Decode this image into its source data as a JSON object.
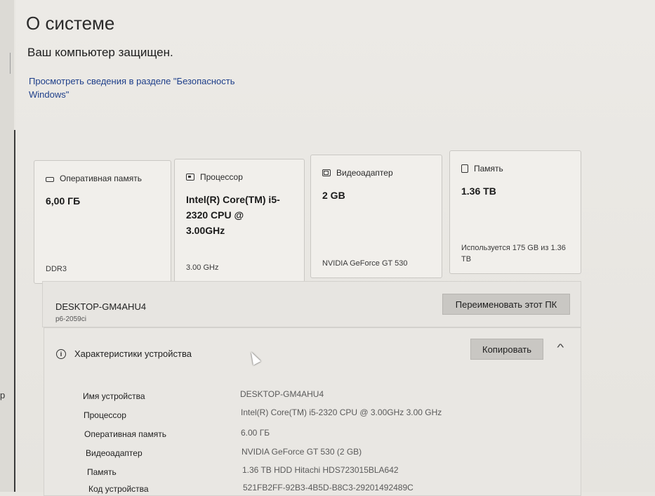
{
  "left_edge_char": "р",
  "page_title": "О системе",
  "protection_status": "Ваш компьютер защищен.",
  "security_link": "Просмотреть сведения в разделе \"Безопасность Windows\"",
  "cards": [
    {
      "icon": "ram-icon",
      "title": "Оперативная память",
      "value": "6,00 ГБ",
      "footer": "DDR3"
    },
    {
      "icon": "cpu-icon",
      "title": "Процессор",
      "value": "Intel(R) Core(TM) i5-2320 CPU @ 3.00GHz",
      "footer": "3.00 GHz"
    },
    {
      "icon": "gpu-icon",
      "title": "Видеоадаптер",
      "value": "2 GB",
      "footer": "NVIDIA GeForce GT 530"
    },
    {
      "icon": "storage-icon",
      "title": "Память",
      "value": "1.36 TB",
      "footer": "Используется 175 GB из 1.36 TB"
    }
  ],
  "device_name": "DESKTOP-GM4AHU4",
  "device_model": "p6-2059ci",
  "rename_button": "Переименовать этот ПК",
  "specs_section_title": "Характеристики устройства",
  "copy_button": "Копировать",
  "specs": [
    {
      "label": "Имя устройства",
      "value": "DESKTOP-GM4AHU4"
    },
    {
      "label": "Процессор",
      "value": "Intel(R) Core(TM) i5-2320 CPU @ 3.00GHz   3.00 GHz"
    },
    {
      "label": "Оперативная память",
      "value": "6.00 ГБ"
    },
    {
      "label": "Видеоадаптер",
      "value": "NVIDIA GeForce GT 530 (2 GB)"
    },
    {
      "label": "Память",
      "value": "1.36 TB HDD Hitachi HDS723015BLA642"
    },
    {
      "label": "Код устройства",
      "value": "521FB2FF-92B3-4B5D-B8C3-29201492489C"
    }
  ]
}
